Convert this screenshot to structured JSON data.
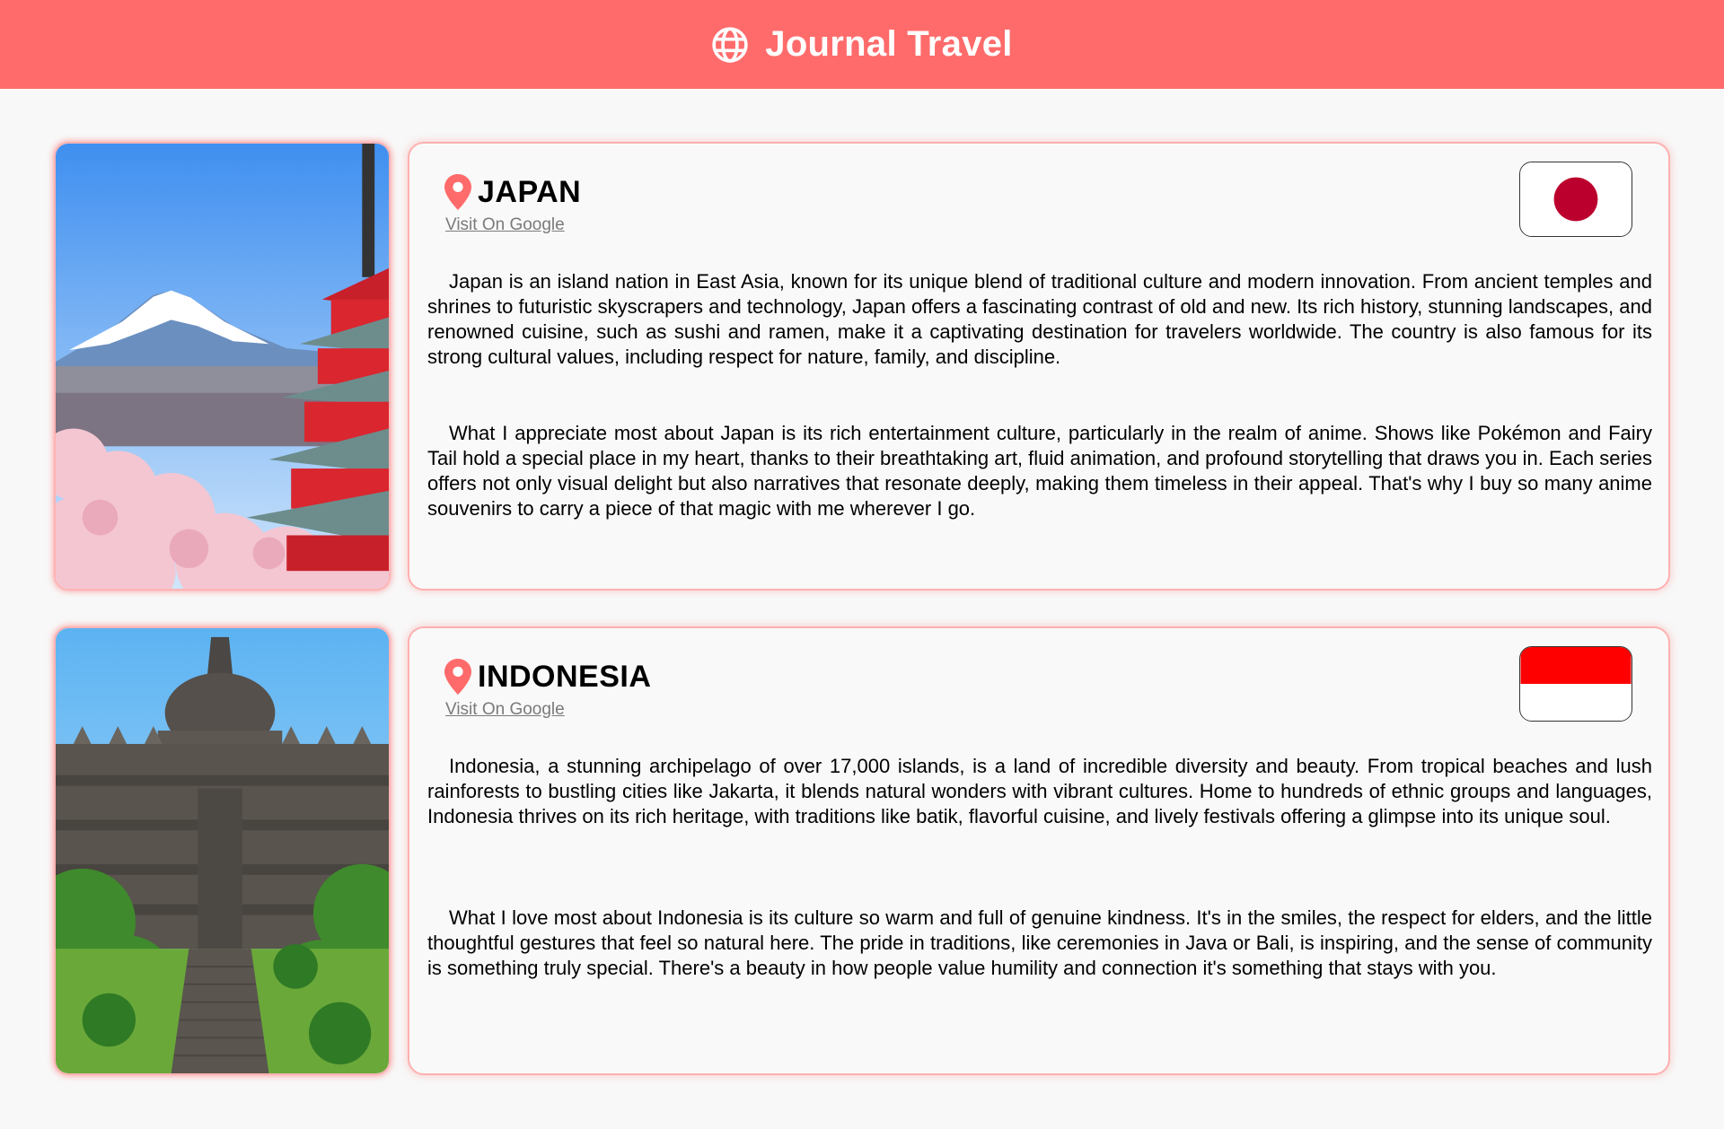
{
  "header": {
    "title": "Journal Travel",
    "icon": "globe-icon",
    "background_color": "#ff6b6b"
  },
  "entries": [
    {
      "country": "JAPAN",
      "link_label": "Visit On Google",
      "photo": "mount-fuji-pagoda-cherry-blossom-photo",
      "flag": "japan-flag",
      "paragraphs": [
        "Japan is an island nation in East Asia, known for its unique blend of traditional culture and modern innovation. From ancient temples and shrines to futuristic skyscrapers and technology, Japan offers a fascinating contrast of old and new. Its rich history, stunning landscapes, and renowned cuisine, such as sushi and ramen, make it a captivating destination for travelers worldwide. The country is also famous for its strong cultural values, including respect for nature, family, and discipline.",
        "What I appreciate most about Japan is its rich entertainment culture, particularly in the realm of anime. Shows like Pokémon and Fairy Tail hold a special place in my heart, thanks to their breathtaking art, fluid animation, and profound storytelling that draws you in. Each series offers not only visual delight but also narratives that resonate deeply, making them timeless in their appeal. That's why I buy so many anime souvenirs to carry a piece of that magic with me wherever I go."
      ]
    },
    {
      "country": "INDONESIA",
      "link_label": "Visit On Google",
      "photo": "borobudur-temple-photo",
      "flag": "indonesia-flag",
      "paragraphs": [
        "Indonesia, a stunning archipelago of over 17,000 islands, is a land of incredible diversity and beauty. From tropical beaches and lush rainforests to bustling cities like Jakarta, it blends natural wonders with vibrant cultures. Home to hundreds of ethnic groups and languages, Indonesia thrives on its rich heritage, with traditions like batik, flavorful cuisine, and lively festivals offering a glimpse into its unique soul.",
        "What I love most about Indonesia is its culture so warm and full of genuine kindness. It's in the smiles, the respect for elders, and the little thoughtful gestures that feel so natural here. The pride in traditions, like ceremonies in Java or Bali, is inspiring, and the sense of community is something truly special. There's a beauty in how people value humility and connection it's something that stays with you."
      ]
    }
  ],
  "colors": {
    "accent": "#ff6b6b",
    "card_border": "#ffb0b0",
    "japan_red": "#bc002d",
    "indonesia_red": "#ff0000"
  }
}
